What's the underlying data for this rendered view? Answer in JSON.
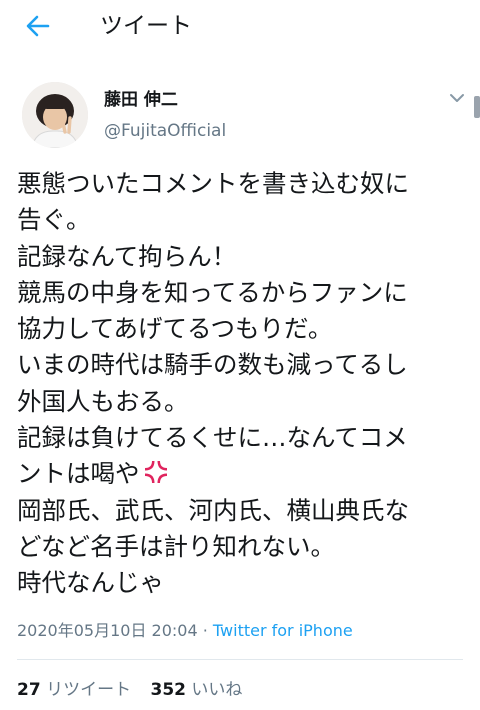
{
  "header": {
    "title": "ツイート"
  },
  "tweet": {
    "display_name": "藤田 伸二",
    "handle": "@FujitaOfficial",
    "lines": [
      "悪態ついたコメントを書き込む奴に",
      "告ぐ。",
      "記録なんて拘らん！",
      "競馬の中身を知ってるからファンに",
      "協力してあげてるつもりだ。",
      "いまの時代は騎手の数も減ってるし",
      "外国人もおる。",
      "記録は負けてるくせに…なんてコメ",
      "ントは喝や",
      "岡部氏、武氏、河内氏、横山典氏な",
      "どなど名手は計り知れない。",
      "時代なんじゃ"
    ],
    "emoji": "anger-symbol",
    "timestamp": "2020年05月10日 20:04",
    "separator": " · ",
    "source": "Twitter for iPhone"
  },
  "stats": {
    "retweet_count": "27",
    "retweet_label": "リツイート",
    "like_count": "352",
    "like_label": "いいね"
  },
  "colors": {
    "accent": "#1da1f2",
    "text": "#14171a",
    "secondary": "#657786",
    "emoji": "#e0245e"
  }
}
